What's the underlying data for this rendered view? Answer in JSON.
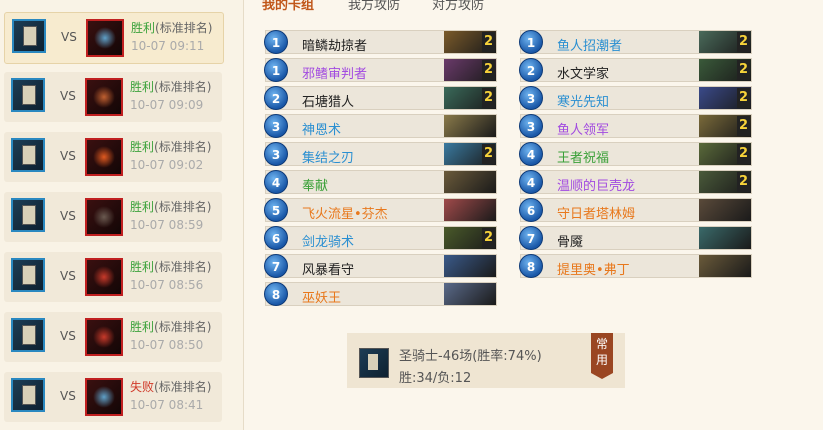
{
  "tabs": [
    {
      "label": "我的卡组",
      "active": true
    },
    {
      "label": "我方攻防",
      "active": false
    },
    {
      "label": "对方攻防",
      "active": false
    }
  ],
  "matches": [
    {
      "vs": "VS",
      "result": "胜利",
      "mode": "(标准排名)",
      "time": "10-07 09:11",
      "active": true,
      "opp_icon": "gear-mech-icon",
      "opp_color": "#5fa0c8"
    },
    {
      "vs": "VS",
      "result": "胜利",
      "mode": "(标准排名)",
      "time": "10-07 09:09",
      "active": false,
      "opp_icon": "bow-icon",
      "opp_color": "#c06030"
    },
    {
      "vs": "VS",
      "result": "胜利",
      "mode": "(标准排名)",
      "time": "10-07 09:02",
      "active": false,
      "opp_icon": "fire-blade-icon",
      "opp_color": "#e05a20"
    },
    {
      "vs": "VS",
      "result": "胜利",
      "mode": "(标准排名)",
      "time": "10-07 08:59",
      "active": false,
      "opp_icon": "spider-icon",
      "opp_color": "#6a5a50"
    },
    {
      "vs": "VS",
      "result": "胜利",
      "mode": "(标准排名)",
      "time": "10-07 08:56",
      "active": false,
      "opp_icon": "demon-sigil-icon",
      "opp_color": "#c83a2a"
    },
    {
      "vs": "VS",
      "result": "胜利",
      "mode": "(标准排名)",
      "time": "10-07 08:50",
      "active": false,
      "opp_icon": "demon-sigil-icon",
      "opp_color": "#c83a2a"
    },
    {
      "vs": "VS",
      "result": "失败",
      "mode": "(标准排名)",
      "time": "10-07 08:41",
      "active": false,
      "opp_icon": "gear-mech-icon",
      "opp_color": "#5fa0c8"
    }
  ],
  "my_deck": [
    {
      "cost": "1",
      "name": "暗鳞劫掠者",
      "rarity": "common",
      "count": "2",
      "art": "#7a5a2a"
    },
    {
      "cost": "1",
      "name": "邪鳍审判者",
      "rarity": "epic",
      "count": "2",
      "art": "#6a3a6a"
    },
    {
      "cost": "2",
      "name": "石塘猎人",
      "rarity": "common",
      "count": "2",
      "art": "#3a6a5a"
    },
    {
      "cost": "3",
      "name": "神恩术",
      "rarity": "rare",
      "count": "",
      "art": "#8a7a4a"
    },
    {
      "cost": "3",
      "name": "集结之刃",
      "rarity": "rare",
      "count": "2",
      "art": "#3a7aa0"
    },
    {
      "cost": "4",
      "name": "奉献",
      "rarity": "free",
      "count": "",
      "art": "#6a5a3a"
    },
    {
      "cost": "5",
      "name": "飞火流星•芬杰",
      "rarity": "legendary",
      "count": "",
      "art": "#a04a4a"
    },
    {
      "cost": "6",
      "name": "剑龙骑术",
      "rarity": "rare",
      "count": "2",
      "art": "#4a5a2a"
    },
    {
      "cost": "7",
      "name": "风暴看守",
      "rarity": "common",
      "count": "",
      "art": "#3a5a8a"
    },
    {
      "cost": "8",
      "name": "巫妖王",
      "rarity": "legendary",
      "count": "",
      "art": "#5a6a8a"
    }
  ],
  "opp_deck": [
    {
      "cost": "1",
      "name": "鱼人招潮者",
      "rarity": "rare",
      "count": "2",
      "art": "#4a6a5a"
    },
    {
      "cost": "2",
      "name": "水文学家",
      "rarity": "common",
      "count": "2",
      "art": "#3a5a3a"
    },
    {
      "cost": "3",
      "name": "寒光先知",
      "rarity": "rare",
      "count": "2",
      "art": "#3a4a8a"
    },
    {
      "cost": "3",
      "name": "鱼人领军",
      "rarity": "epic",
      "count": "2",
      "art": "#7a6a3a"
    },
    {
      "cost": "4",
      "name": "王者祝福",
      "rarity": "free",
      "count": "2",
      "art": "#5a6a3a"
    },
    {
      "cost": "4",
      "name": "温顺的巨壳龙",
      "rarity": "epic",
      "count": "2",
      "art": "#4a5a3a"
    },
    {
      "cost": "6",
      "name": "守日者塔林姆",
      "rarity": "legendary",
      "count": "",
      "art": "#5a4a3a"
    },
    {
      "cost": "7",
      "name": "骨魇",
      "rarity": "common",
      "count": "",
      "art": "#3a6a6a"
    },
    {
      "cost": "8",
      "name": "提里奥•弗丁",
      "rarity": "legendary",
      "count": "",
      "art": "#6a5a3a"
    }
  ],
  "summary": {
    "record": "圣骑士-46场(胜率:74%)",
    "wl": "胜:34/负:12",
    "badge": "常用"
  },
  "colors": {
    "win": "#3ca23c",
    "lose": "#d03a2a",
    "accent": "#c0571a",
    "mana": "#1a58a8"
  }
}
